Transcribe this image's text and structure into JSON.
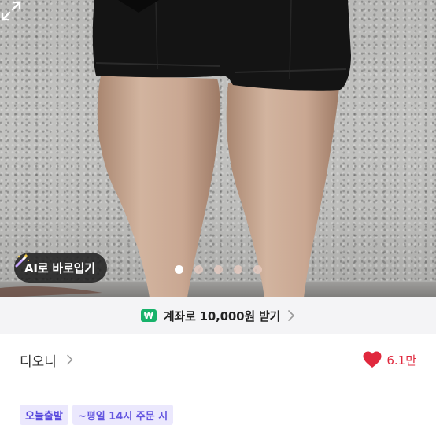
{
  "hero": {
    "ai_button_label": "AI로 바로입기",
    "ai_icon": "magic-wand-icon",
    "expand_icon": "expand-arrows-icon",
    "carousel": {
      "total": 5,
      "active_index": 0
    }
  },
  "banner": {
    "icon_text": "₩",
    "text": "계좌로 10,000원 받기",
    "chevron_icon": "chevron-right-icon"
  },
  "seller": {
    "name": "디오니",
    "chevron_icon": "chevron-right-icon"
  },
  "likes": {
    "icon": "heart-icon",
    "count": "6.1만",
    "color": "#e0283d"
  },
  "delivery": {
    "badge_label": "오늘출발",
    "condition": "~평일 14시 주문 시"
  },
  "colors": {
    "accent_purple": "#5b4cde",
    "badge_bg": "#ebe8fd",
    "won_green": "#17b26a"
  }
}
